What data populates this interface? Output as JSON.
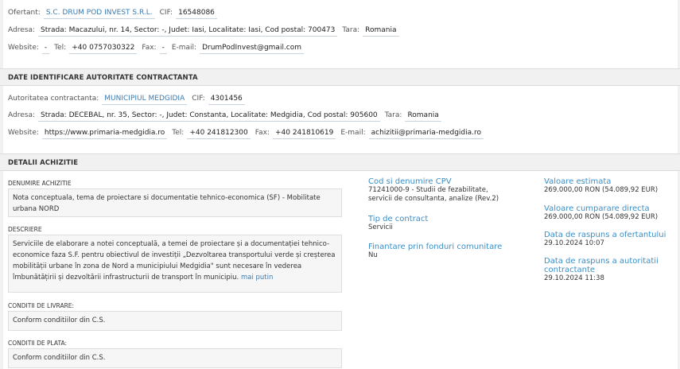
{
  "ofertant": {
    "label": "Ofertant:",
    "name": "S.C. DRUM POD INVEST S.R.L.",
    "cif_label": "CIF:",
    "cif": "16548086",
    "adresa_label": "Adresa:",
    "adresa": "Strada: Macazului, nr. 14, Sector: -, Judet: Iasi, Localitate: Iasi, Cod postal: 700473",
    "tara_label": "Tara:",
    "tara": "Romania",
    "website_label": "Website:",
    "website": "-",
    "tel_label": "Tel:",
    "tel": "+40 0757030322",
    "fax_label": "Fax:",
    "fax": "-",
    "email_label": "E-mail:",
    "email": "DrumPodInvest@gmail.com"
  },
  "autoritate": {
    "section_title": "DATE IDENTIFICARE AUTORITATE CONTRACTANTA",
    "label": "Autoritatea contractanta:",
    "name": "MUNICIPIUL MEDGIDIA",
    "cif_label": "CIF:",
    "cif": "4301456",
    "adresa_label": "Adresa:",
    "adresa": "Strada: DECEBAL, nr. 35, Sector: -, Judet: Constanta, Localitate: Medgidia, Cod postal: 905600",
    "tara_label": "Tara:",
    "tara": "Romania",
    "website_label": "Website:",
    "website": "https://www.primaria-medgidia.ro",
    "tel_label": "Tel:",
    "tel": "+40 241812300",
    "fax_label": "Fax:",
    "fax": "+40 241810619",
    "email_label": "E-mail:",
    "email": "achizitii@primaria-medgidia.ro"
  },
  "achizitie": {
    "section_title": "DETALII ACHIZITIE",
    "denumire_label": "DENUMIRE ACHIZITIE",
    "denumire": "Nota conceptuala, tema de proiectare si documentatie tehnico-economica (SF) - Mobilitate urbana NORD",
    "descriere_label": "DESCRIERE",
    "descriere": "Serviciile de elaborare a notei conceptuală, a temei de proiectare și a documentației tehnico-economice faza S.F. pentru obiectivul de investiții „Dezvoltarea transportului verde și creșterea mobilității urbane în zona de Nord a municipiului Medgidia\" sunt necesare în vederea îmbunătățirii și dezvoltării infrastructurii de transport în municipiu.",
    "mai_putin": "mai putin",
    "livrare_label": "CONDITII DE LIVRARE:",
    "livrare": "Conform conditiilor din C.S.",
    "plata_label": "CONDITII DE PLATA:",
    "plata": "Conform conditiilor din C.S.",
    "cpv_label": "Cod si denumire CPV",
    "cpv": "71241000-9 - Studii de fezabilitate, servicii de consultanta, analize (Rev.2)",
    "tip_label": "Tip de contract",
    "tip": "Servicii",
    "finantare_label": "Finantare prin fonduri comunitare",
    "finantare": "Nu",
    "valoare_estimata_label": "Valoare estimata",
    "valoare_estimata": "269.000,00 RON (54.089,92 EUR)",
    "valoare_cumparare_label": "Valoare cumparare directa",
    "valoare_cumparare": "269.000,00 RON (54.089,92 EUR)",
    "raspuns_ofertant_label": "Data de raspuns a ofertantului",
    "raspuns_ofertant": "29.10.2024 10:07",
    "raspuns_autoritate_label": "Data de raspuns a autoritatii contractante",
    "raspuns_autoritate": "29.10.2024 11:38"
  }
}
